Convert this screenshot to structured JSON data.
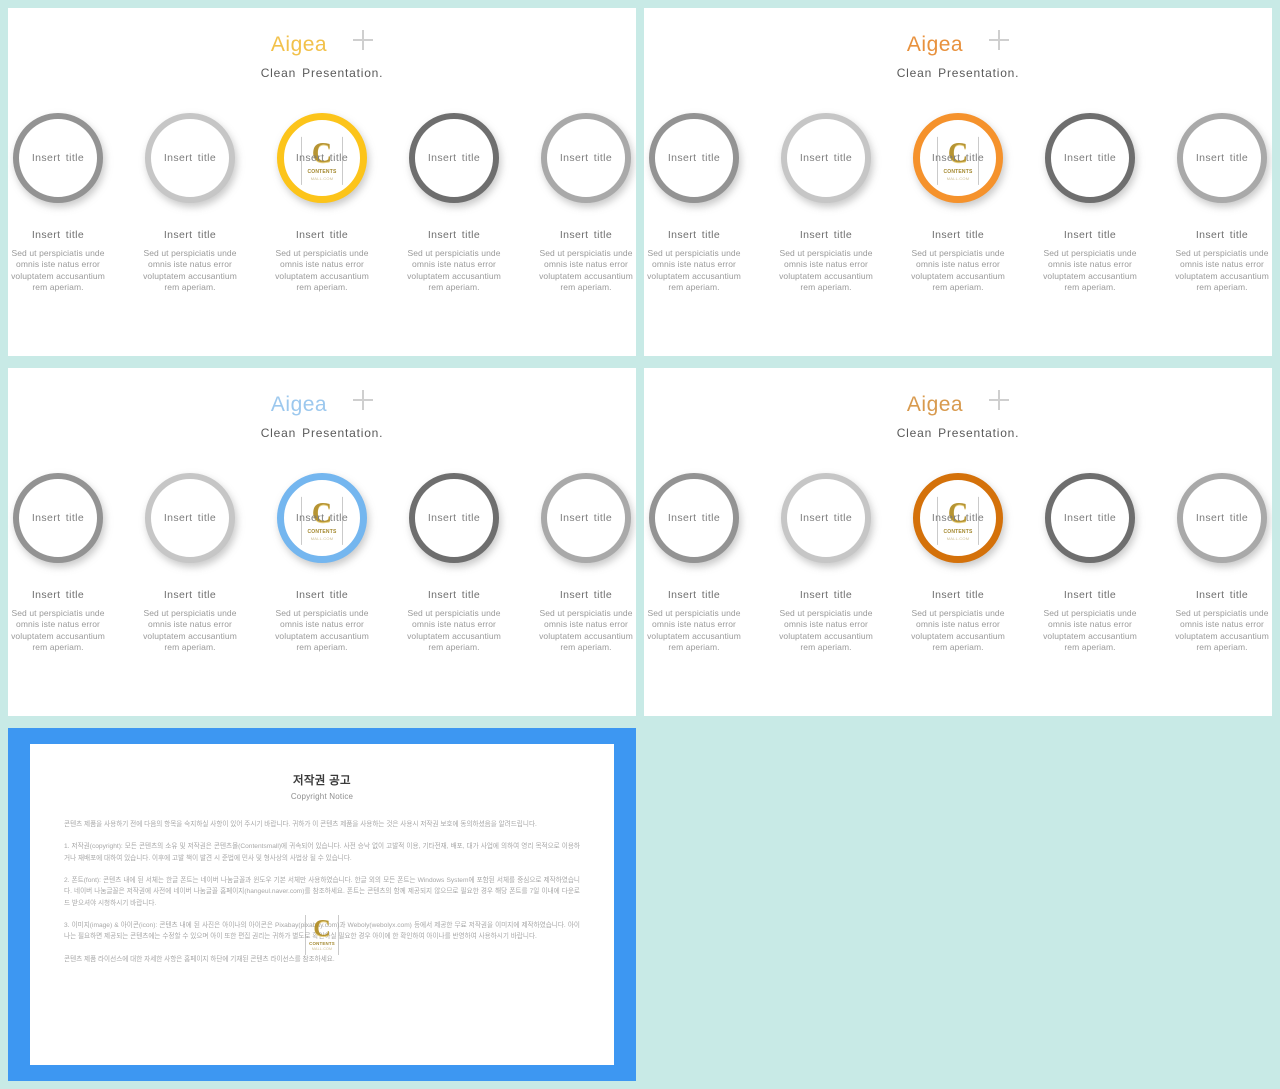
{
  "background_color": "#c8eae6",
  "watermark": {
    "letter": "C",
    "line1": "CONTENTS",
    "line2": "MALL.COM"
  },
  "slides": [
    {
      "id": "slide-1",
      "brand": "Aigea",
      "brand_color": "#f2c14a",
      "tagline": "Clean  Presentation.",
      "accent_color": "#fcc41a",
      "highlight_index": 2,
      "ring_colors": [
        "#939393",
        "#c6c6c6",
        "#fcc41a",
        "#6e6e6e",
        "#a9a9a9"
      ],
      "items": [
        {
          "ring_label": "Insert  title",
          "title": "Insert  title",
          "body": "Sed ut perspiciatis unde omnis iste natus error voluptatem accusantium rem aperiam."
        },
        {
          "ring_label": "Insert  title",
          "title": "Insert  title",
          "body": "Sed ut perspiciatis unde omnis iste natus error voluptatem accusantium rem aperiam."
        },
        {
          "ring_label": "Insert  title",
          "title": "Insert  title",
          "body": "Sed ut perspiciatis unde omnis iste natus error voluptatem accusantium rem aperiam."
        },
        {
          "ring_label": "Insert  title",
          "title": "Insert  title",
          "body": "Sed ut perspiciatis unde omnis iste natus error voluptatem accusantium rem aperiam."
        },
        {
          "ring_label": "Insert  title",
          "title": "Insert  title",
          "body": "Sed ut perspiciatis unde omnis iste natus error voluptatem accusantium rem aperiam."
        }
      ]
    },
    {
      "id": "slide-2",
      "brand": "Aigea",
      "brand_color": "#e8913d",
      "tagline": "Clean  Presentation.",
      "accent_color": "#f5922c",
      "highlight_index": 2,
      "ring_colors": [
        "#939393",
        "#c6c6c6",
        "#f5922c",
        "#6e6e6e",
        "#a9a9a9"
      ],
      "items": [
        {
          "ring_label": "Insert  title",
          "title": "Insert  title",
          "body": "Sed ut perspiciatis unde omnis iste natus error voluptatem accusantium rem aperiam."
        },
        {
          "ring_label": "Insert  title",
          "title": "Insert  title",
          "body": "Sed ut perspiciatis unde omnis iste natus error voluptatem accusantium rem aperiam."
        },
        {
          "ring_label": "Insert  title",
          "title": "Insert  title",
          "body": "Sed ut perspiciatis unde omnis iste natus error voluptatem accusantium rem aperiam."
        },
        {
          "ring_label": "Insert  title",
          "title": "Insert  title",
          "body": "Sed ut perspiciatis unde omnis iste natus error voluptatem accusantium rem aperiam."
        },
        {
          "ring_label": "Insert  title",
          "title": "Insert  title",
          "body": "Sed ut perspiciatis unde omnis iste natus error voluptatem accusantium rem aperiam."
        }
      ]
    },
    {
      "id": "slide-3",
      "brand": "Aigea",
      "brand_color": "#9cc8ee",
      "tagline": "Clean  Presentation.",
      "accent_color": "#74b6ef",
      "highlight_index": 2,
      "ring_colors": [
        "#939393",
        "#c6c6c6",
        "#74b6ef",
        "#6e6e6e",
        "#a9a9a9"
      ],
      "items": [
        {
          "ring_label": "Insert  title",
          "title": "Insert  title",
          "body": "Sed ut perspiciatis unde omnis iste natus error voluptatem accusantium rem aperiam."
        },
        {
          "ring_label": "Insert  title",
          "title": "Insert  title",
          "body": "Sed ut perspiciatis unde omnis iste natus error voluptatem accusantium rem aperiam."
        },
        {
          "ring_label": "Insert  title",
          "title": "Insert  title",
          "body": "Sed ut perspiciatis unde omnis iste natus error voluptatem accusantium rem aperiam."
        },
        {
          "ring_label": "Insert  title",
          "title": "Insert  title",
          "body": "Sed ut perspiciatis unde omnis iste natus error voluptatem accusantium rem aperiam."
        },
        {
          "ring_label": "Insert  title",
          "title": "Insert  title",
          "body": "Sed ut perspiciatis unde omnis iste natus error voluptatem accusantium rem aperiam."
        }
      ]
    },
    {
      "id": "slide-4",
      "brand": "Aigea",
      "brand_color": "#d89a4e",
      "tagline": "Clean  Presentation.",
      "accent_color": "#d4710a",
      "highlight_index": 2,
      "ring_colors": [
        "#939393",
        "#c6c6c6",
        "#d4710a",
        "#6e6e6e",
        "#a9a9a9"
      ],
      "items": [
        {
          "ring_label": "Insert  title",
          "title": "Insert  title",
          "body": "Sed ut perspiciatis unde omnis iste natus error voluptatem accusantium rem aperiam."
        },
        {
          "ring_label": "Insert  title",
          "title": "Insert  title",
          "body": "Sed ut perspiciatis unde omnis iste natus error voluptatem accusantium rem aperiam."
        },
        {
          "ring_label": "Insert  title",
          "title": "Insert  title",
          "body": "Sed ut perspiciatis unde omnis iste natus error voluptatem accusantium rem aperiam."
        },
        {
          "ring_label": "Insert  title",
          "title": "Insert  title",
          "body": "Sed ut perspiciatis unde omnis iste natus error voluptatem accusantium rem aperiam."
        },
        {
          "ring_label": "Insert  title",
          "title": "Insert  title",
          "body": "Sed ut perspiciatis unde omnis iste natus error voluptatem accusantium rem aperiam."
        }
      ]
    }
  ],
  "copyright_slide": {
    "frame_color": "#3d97f2",
    "title": "저작권 공고",
    "subtitle": "Copyright Notice",
    "paragraphs": [
      "콘텐츠 제품을 사용하기 전에 다음의 항목을 숙지하실 사항이 있어 주시기 바랍니다. 귀하가 이 콘텐츠 제품을 사용하는 것은 사용시 저작권 보호에 동의하셨음을 알려드립니다.",
      "1. 저작권(copyright): 모든 콘텐츠의 소유 및 저작권은 콘텐츠몰(Contentsmall)에 귀속되어 있습니다. 사전 승낙 없이 고발적 이용, 기타전재, 배포, 대가 사업에 의하여 영리 목적으로 이용하거나 재배포에 대하여 있습니다. 이후에 고발 책이 발견 시 준법에 민사 및 형사상의 사법상 될 수 있습니다.",
      "2. 폰트(font): 콘텐츠 내에 된 서체는 한글 폰트는 네이버 나눔글꼴과 윈도우 기본 서체만 사용하였습니다. 한글 외의 모든 폰트는 Windows System에 포함된 서체를 중심으로 제작하였습니다. 네이버 나눔글꼴은 저작권에 사전에 네이버 나눔글꼴 홈페이지(hangeul.naver.com)를 참조하세요. 폰트는 콘텐츠의 함께 제공되지 않으므로 필요한 경우 해당 폰트를 7일 이내에 다운로드 받으셔야 시청하시기 바랍니다.",
      "3. 이미지(image) & 아이콘(icon): 콘텐츠 내에 된 사진은 아이나의 아이콘은 Pixabay(pixabay.com)과 Weboly(webolyx.com) 등에서 제공한 무료 저작권을 이미지에 제작하였습니다. 아이나는 필요하면 제공되는 콘텐츠에는 수정할 수 있으며 아이 또한 편집 권리는 귀하가 별도로 확인하실 필요한 경우 아이에 한 확인하여 아이나를 반영하여 사용하시기 바랍니다.",
      "콘텐츠 제품 라이선스에 대한 자세한 사항은 홈페이지 하단에 기재된 콘텐츠 라이선스를 참조하세요."
    ]
  }
}
